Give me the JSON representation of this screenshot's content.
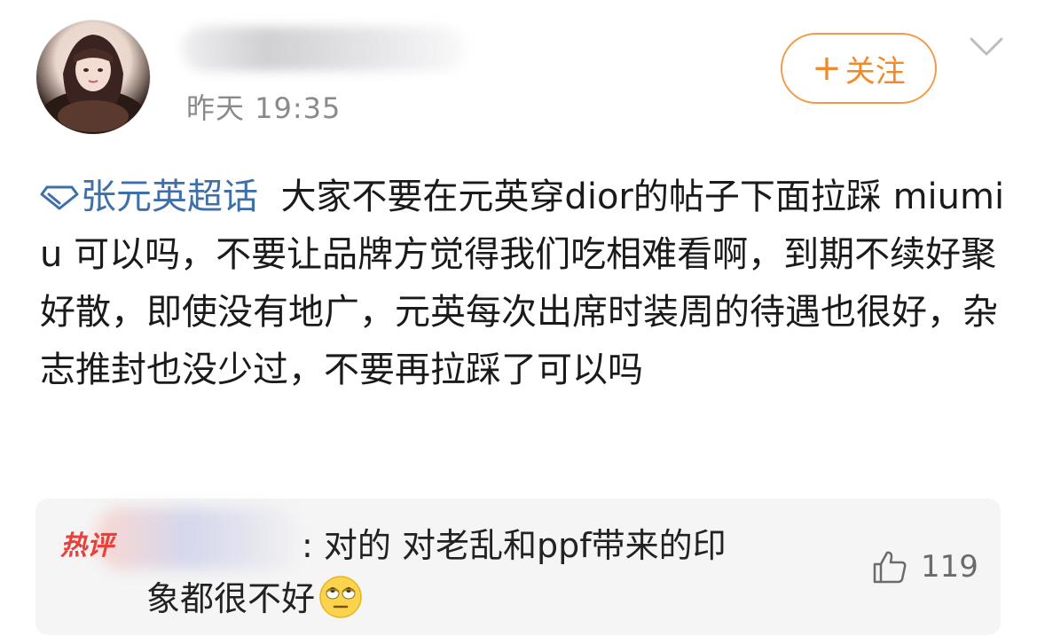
{
  "post": {
    "timestamp": "昨天 19:35",
    "follow_label": "关注",
    "follow_prefix": "+",
    "topic": "张元英超话",
    "body": "大家不要在元英穿dior的帖子下面拉踩 miumiu 可以吗，不要让品牌方觉得我们吃相难看啊，到期不续好聚好散，即使没有地广，元英每次出席时装周的待遇也很好，杂志推封也没少过，不要再拉踩了可以吗"
  },
  "comment": {
    "hot_badge": "热评",
    "text_line1": ": 对的 对老乱和ppf带来的印",
    "text_line2": "象都很不好",
    "likes": "119"
  },
  "colors": {
    "accent_orange": "#f08a2a",
    "topic_blue": "#3f6fa8",
    "hot_red": "#e8403a"
  },
  "icons": {
    "topic": "diamond-icon",
    "more": "chevron-down-icon",
    "like": "thumbs-up-icon",
    "emoji": "rolling-eyes-emoji"
  }
}
